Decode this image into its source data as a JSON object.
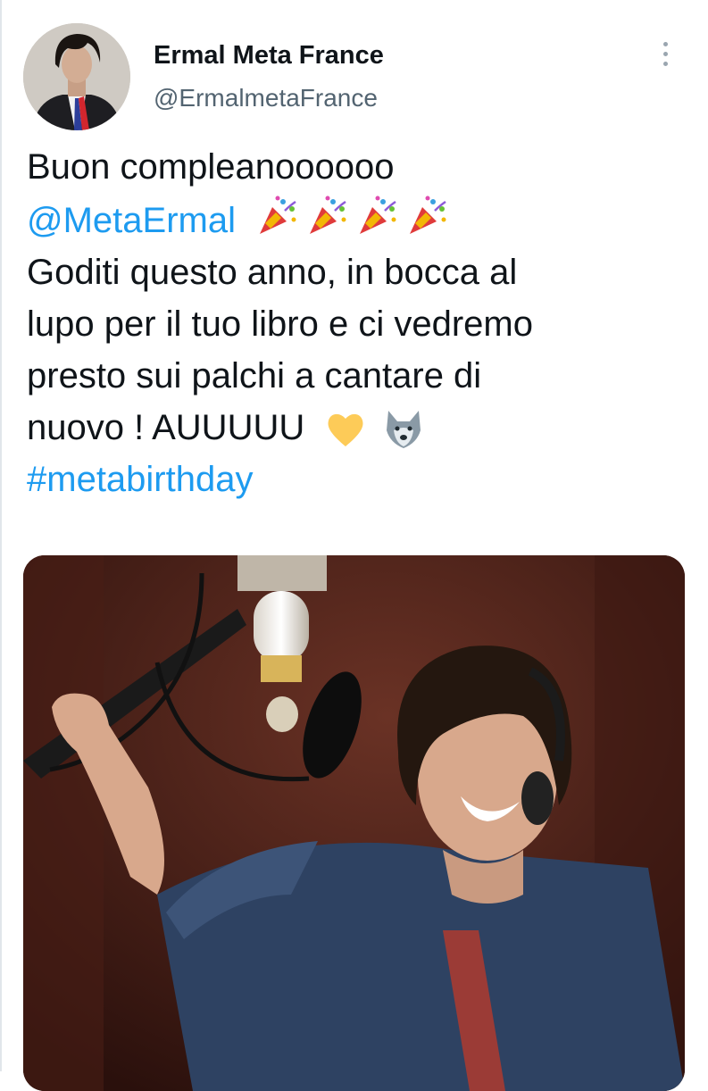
{
  "author": {
    "name": "Ermal Meta France",
    "handle": "@ErmalmetaFrance"
  },
  "tweet": {
    "line1": "Buon compleanoooooo",
    "mention": "@MetaErmal",
    "line3": "Goditi questo anno, in bocca al",
    "line4": "lupo per il tuo libro e ci vedremo",
    "line5": "presto sui palchi a cantare di",
    "line6": "nuovo ! AUUUUU",
    "hashtag": "#metabirthday",
    "emojis_after_mention": [
      "party-popper",
      "party-popper",
      "party-popper",
      "party-popper"
    ],
    "emojis_after_text": [
      "yellow-heart",
      "wolf-face"
    ]
  },
  "colors": {
    "link": "#1d9bf0",
    "text": "#0f1419",
    "secondary": "#536471"
  },
  "icons": {
    "more_menu": "more-vertical-icon"
  }
}
